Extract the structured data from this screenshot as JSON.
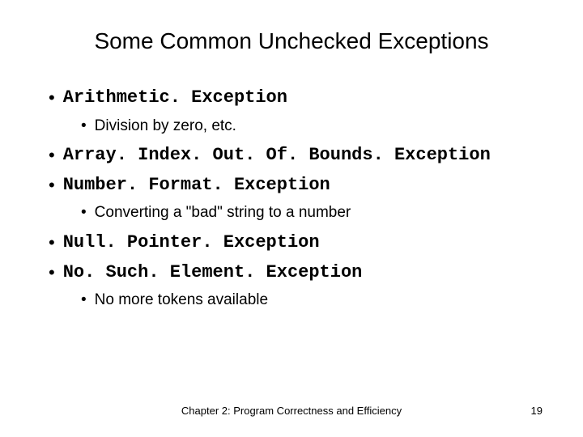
{
  "slide": {
    "title": "Some Common Unchecked Exceptions",
    "items": [
      {
        "text": "Arithmetic. Exception",
        "mono": true,
        "sub": "Division by zero, etc."
      },
      {
        "text": "Array. Index. Out. Of. Bounds. Exception",
        "mono": true
      },
      {
        "text": "Number. Format. Exception",
        "mono": true,
        "sub": "Converting a \"bad\" string to a number"
      },
      {
        "text": "Null. Pointer. Exception",
        "mono": true
      },
      {
        "text": "No. Such. Element. Exception",
        "mono": true,
        "sub": "No more tokens available"
      }
    ],
    "footer": "Chapter 2: Program Correctness and Efficiency",
    "page": "19"
  }
}
